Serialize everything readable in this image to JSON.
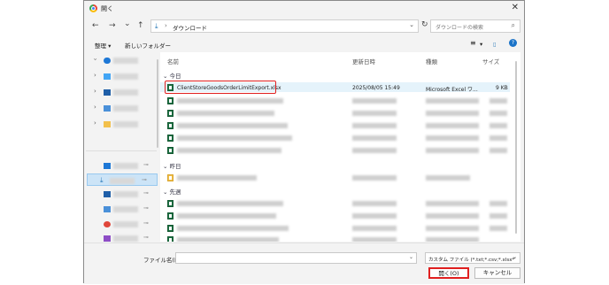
{
  "window": {
    "title": "開く",
    "close_glyph": "✕"
  },
  "navigation": {
    "back": "←",
    "forward": "→",
    "dropdown": "⌄",
    "up": "↑",
    "address_icon": "download-icon",
    "address_sep": "›",
    "address_path": "ダウンロード",
    "refresh": "↻"
  },
  "search": {
    "placeholder": "ダウンロードの検索",
    "icon": "⌕"
  },
  "toolbar": {
    "organize": "整理",
    "organize_caret": "▾",
    "new_folder": "新しいフォルダー",
    "view_icon": "≡",
    "view_caret": "▾",
    "pane_icon": "▯",
    "help_icon": "?"
  },
  "columns": {
    "name": "名前",
    "modified": "更新日時",
    "type": "種類",
    "size": "サイズ"
  },
  "groups": {
    "today": "今日",
    "yesterday": "昨日",
    "last_week": "先週",
    "caret": "⌄"
  },
  "selected_file": {
    "name": "ClientStoreGoodsOrderLimitExport.xlsx",
    "modified": "2025/08/05 15:49",
    "type": "Microsoft Excel ワ...",
    "size": "9 KB"
  },
  "nav_chevron": "›",
  "pin_glyph": "📌",
  "bottom": {
    "filename_label": "ファイル名(N):",
    "filename_value": "",
    "filetype": "カスタム ファイル (*.txt;*.csv;*.xlsx*",
    "filetype_caret": "⌄",
    "open": "開く(O)",
    "cancel": "キャンセル"
  },
  "colors": {
    "highlight": "#e02020",
    "selection": "#e5f3fb",
    "excel": "#1e7145"
  }
}
